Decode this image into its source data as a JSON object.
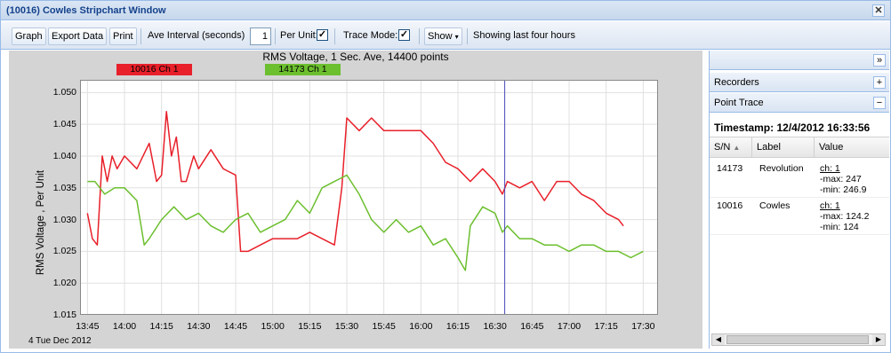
{
  "window": {
    "title": "(10016) Cowles Stripchart Window"
  },
  "toolbar": {
    "graph_label": "Graph",
    "export_label": "Export Data",
    "print_label": "Print",
    "ave_interval_label": "Ave Interval (seconds)",
    "ave_interval_value": "1",
    "per_unit_label": "Per Unit:",
    "per_unit_checked": true,
    "trace_mode_label": "Trace Mode:",
    "trace_mode_checked": true,
    "show_label": "Show",
    "status_text": "Showing last four hours"
  },
  "side": {
    "expand_icon": "double-chevron-right-icon",
    "recorders_label": "Recorders",
    "point_trace_label": "Point Trace",
    "timestamp": "Timestamp: 12/4/2012 16:33:56",
    "columns": [
      "S/N",
      "Label",
      "Value"
    ],
    "rows": [
      {
        "sn": "14173",
        "label": "Revolution",
        "ch": "ch: 1",
        "max": "-max: 247",
        "min": "-min: 246.9"
      },
      {
        "sn": "10016",
        "label": "Cowles",
        "ch": "ch: 1",
        "max": "-max: 124.2",
        "min": "-min: 124"
      }
    ]
  },
  "chart_data": {
    "type": "line",
    "title": "RMS Voltage, 1 Sec. Ave, 14400 points",
    "ylabel": "RMS Voltage , Per Unit",
    "xlabel": "",
    "date_label": "4 Tue Dec 2012",
    "ylim": [
      1.015,
      1.052
    ],
    "yticks": [
      "1.050",
      "1.045",
      "1.040",
      "1.035",
      "1.030",
      "1.025",
      "1.020",
      "1.015"
    ],
    "xticks": [
      "13:45",
      "14:00",
      "14:15",
      "14:30",
      "14:45",
      "15:00",
      "15:15",
      "15:30",
      "15:45",
      "16:00",
      "16:15",
      "16:30",
      "16:45",
      "17:00",
      "17:15",
      "17:30"
    ],
    "cursor_time": "16:33:56",
    "colors": {
      "ch1_red": "#e8202a",
      "ch1_green": "#6cbf2e",
      "cursor": "#4a4ab8"
    },
    "series": [
      {
        "name": "10016 Ch 1",
        "color": "#e8202a",
        "times": [
          "13:45",
          "13:47",
          "13:49",
          "13:51",
          "13:53",
          "13:55",
          "13:57",
          "14:00",
          "14:05",
          "14:10",
          "14:13",
          "14:15",
          "14:17",
          "14:19",
          "14:21",
          "14:23",
          "14:25",
          "14:28",
          "14:30",
          "14:35",
          "14:40",
          "14:45",
          "14:47",
          "14:50",
          "14:55",
          "15:00",
          "15:05",
          "15:10",
          "15:15",
          "15:20",
          "15:25",
          "15:28",
          "15:30",
          "15:35",
          "15:40",
          "15:45",
          "15:50",
          "15:55",
          "16:00",
          "16:05",
          "16:10",
          "16:15",
          "16:20",
          "16:25",
          "16:30",
          "16:33",
          "16:35",
          "16:40",
          "16:45",
          "16:50",
          "16:55",
          "17:00",
          "17:05",
          "17:10",
          "17:15",
          "17:20",
          "17:22"
        ],
        "values": [
          1.031,
          1.027,
          1.026,
          1.04,
          1.036,
          1.04,
          1.038,
          1.04,
          1.038,
          1.042,
          1.036,
          1.037,
          1.047,
          1.04,
          1.043,
          1.036,
          1.036,
          1.04,
          1.038,
          1.041,
          1.038,
          1.037,
          1.025,
          1.025,
          1.026,
          1.027,
          1.027,
          1.027,
          1.028,
          1.027,
          1.026,
          1.035,
          1.046,
          1.044,
          1.046,
          1.044,
          1.044,
          1.044,
          1.044,
          1.042,
          1.039,
          1.038,
          1.036,
          1.038,
          1.036,
          1.034,
          1.036,
          1.035,
          1.036,
          1.033,
          1.036,
          1.036,
          1.034,
          1.033,
          1.031,
          1.03,
          1.029
        ]
      },
      {
        "name": "14173 Ch 1",
        "color": "#6cbf2e",
        "times": [
          "13:45",
          "13:48",
          "13:52",
          "13:56",
          "14:00",
          "14:05",
          "14:08",
          "14:10",
          "14:15",
          "14:20",
          "14:25",
          "14:30",
          "14:35",
          "14:40",
          "14:45",
          "14:50",
          "14:55",
          "15:00",
          "15:05",
          "15:10",
          "15:15",
          "15:20",
          "15:25",
          "15:30",
          "15:35",
          "15:40",
          "15:45",
          "15:50",
          "15:55",
          "16:00",
          "16:05",
          "16:10",
          "16:15",
          "16:18",
          "16:20",
          "16:25",
          "16:30",
          "16:33",
          "16:35",
          "16:40",
          "16:45",
          "16:50",
          "16:55",
          "17:00",
          "17:05",
          "17:10",
          "17:15",
          "17:20",
          "17:25",
          "17:30"
        ],
        "values": [
          1.036,
          1.036,
          1.034,
          1.035,
          1.035,
          1.033,
          1.026,
          1.027,
          1.03,
          1.032,
          1.03,
          1.031,
          1.029,
          1.028,
          1.03,
          1.031,
          1.028,
          1.029,
          1.03,
          1.033,
          1.031,
          1.035,
          1.036,
          1.037,
          1.034,
          1.03,
          1.028,
          1.03,
          1.028,
          1.029,
          1.026,
          1.027,
          1.024,
          1.022,
          1.029,
          1.032,
          1.031,
          1.028,
          1.029,
          1.027,
          1.027,
          1.026,
          1.026,
          1.025,
          1.026,
          1.026,
          1.025,
          1.025,
          1.024,
          1.025
        ]
      }
    ]
  }
}
